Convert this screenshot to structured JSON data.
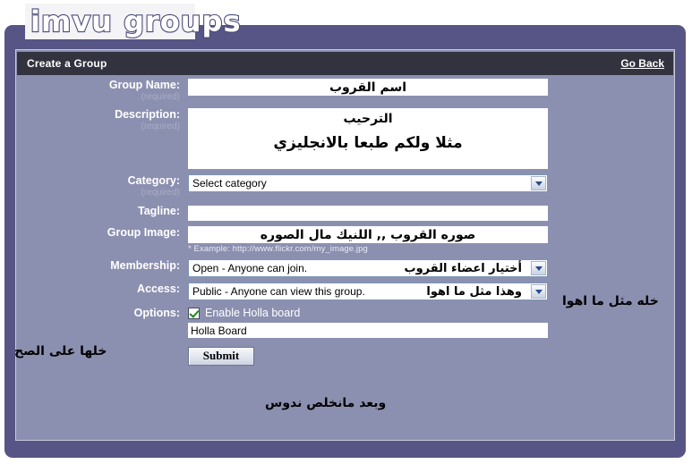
{
  "logo": {
    "text": "imvu groups"
  },
  "header": {
    "title": "Create a Group",
    "go_back": "Go Back"
  },
  "colors": {
    "page_bg": "#ffffff",
    "outer_frame": "#565585",
    "panel_bg": "#8c90b0",
    "header_bar": "#333340",
    "label_text": "#ffffff",
    "required_text": "#a9acc6",
    "check_green": "#1a8a1a",
    "chevron_blue": "#2a4b8d"
  },
  "form": {
    "group_name": {
      "label": "Group Name:",
      "required_note": "(required)",
      "value": "اسم القروب"
    },
    "description": {
      "label": "Description:",
      "required_note": "(required)",
      "value_line1": "الترحيب",
      "value_line2": "مثلا ولكم طبعا بالانجليزي"
    },
    "category": {
      "label": "Category:",
      "required_note": "(required)",
      "selected": "Select category",
      "icon": "chevron-down-icon"
    },
    "tagline": {
      "label": "Tagline:",
      "value": ""
    },
    "group_image": {
      "label": "Group Image:",
      "value": "صوره القروب ,, اللنيك مال الصوره",
      "hint": "* Example: http://www.flickr.com/my_image.jpg"
    },
    "membership": {
      "label": "Membership:",
      "selected": "Open - Anyone can join.",
      "overlay_note": "أختيار اعضاء القروب",
      "icon": "chevron-down-icon"
    },
    "access": {
      "label": "Access:",
      "selected": "Public - Anyone can view this group.",
      "overlay_note": "وهذا مثل ما اهوا",
      "icon": "chevron-down-icon"
    },
    "options": {
      "label": "Options:",
      "checkbox_label": "Enable Holla board",
      "checkbox_checked": true,
      "board_name_value": "Holla Board"
    },
    "submit": {
      "label": "Submit"
    }
  },
  "annotations": {
    "membership_note": "خله مثل ما اهوا",
    "options_note": "خلها على الصح",
    "submit_note": "وبعد مانخلص ندوس"
  }
}
